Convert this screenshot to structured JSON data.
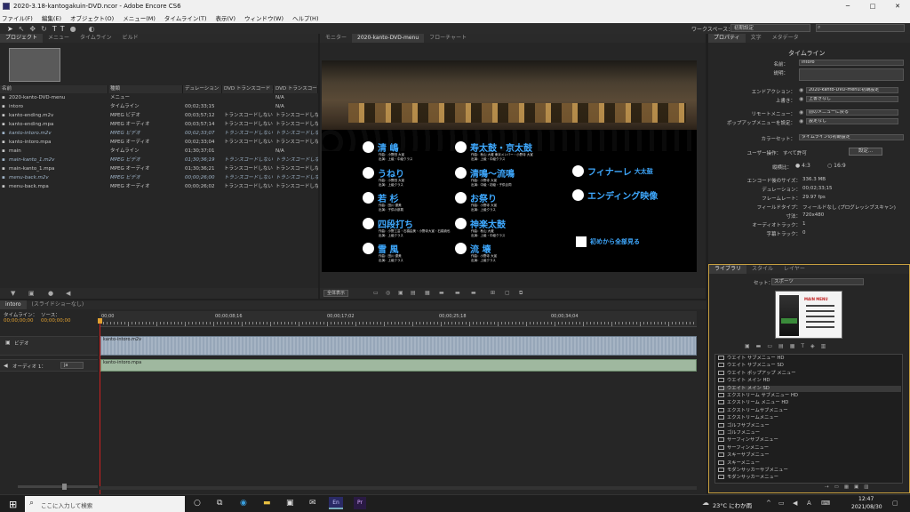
{
  "app": {
    "title": "2020-3.18-kantogakuin-DVD.ncor - Adobe Encore CS6",
    "window_controls": [
      "─",
      "□",
      "✕"
    ]
  },
  "menubar": [
    "ファイル(F)",
    "編集(E)",
    "オブジェクト(O)",
    "メニュー(M)",
    "タイムライン(T)",
    "表示(V)",
    "ウィンドウ(W)",
    "ヘルプ(H)"
  ],
  "workspace": {
    "label": "ワークスペース：",
    "value": "初期設定"
  },
  "project_panel": {
    "tabs": [
      "プロジェクト",
      "メニュー",
      "タイムライン",
      "ビルド"
    ],
    "columns": [
      "名前",
      "種類",
      "デュレーション",
      "DVD トランスコード ス...",
      "DVD トランスコード..."
    ],
    "rows": [
      {
        "name": "2020-kanto-DVD-menu",
        "type": "メニュー",
        "duration": "",
        "t1": "",
        "t2": "N/A",
        "italic": false
      },
      {
        "name": "intoro",
        "type": "タイムライン",
        "duration": "00;02;33;15",
        "t1": "",
        "t2": "N/A",
        "italic": false
      },
      {
        "name": "kanto-ending.m2v",
        "type": "MPEG ビデオ",
        "duration": "00;03;57;12",
        "t1": "トランスコードしない",
        "t2": "トランスコードしない",
        "italic": false
      },
      {
        "name": "kanto-ending.mpa",
        "type": "MPEG オーディオ",
        "duration": "00;03;57;14",
        "t1": "トランスコードしない",
        "t2": "トランスコードしない",
        "italic": false
      },
      {
        "name": "kanto-intoro.m2v",
        "type": "MPEG ビデオ",
        "duration": "00;02;33;07",
        "t1": "トランスコードしない",
        "t2": "トランスコードしない",
        "italic": true
      },
      {
        "name": "kanto-intoro.mpa",
        "type": "MPEG オーディオ",
        "duration": "00;02;33;04",
        "t1": "トランスコードしない",
        "t2": "トランスコードしない",
        "italic": false
      },
      {
        "name": "main",
        "type": "タイムライン",
        "duration": "01;30;37;01",
        "t1": "",
        "t2": "N/A",
        "italic": false
      },
      {
        "name": "main-kanto_1.m2v",
        "type": "MPEG ビデオ",
        "duration": "01;30;36;19",
        "t1": "トランスコードしない",
        "t2": "トランスコードしない",
        "italic": true
      },
      {
        "name": "main-kanto_1.mpa",
        "type": "MPEG オーディオ",
        "duration": "01;30;36;21",
        "t1": "トランスコードしない",
        "t2": "トランスコードしない",
        "italic": false
      },
      {
        "name": "menu-back.m2v",
        "type": "MPEG ビデオ",
        "duration": "00;00;26;00",
        "t1": "トランスコードしない",
        "t2": "トランスコードしない",
        "italic": true
      },
      {
        "name": "menu-back.mpa",
        "type": "MPEG オーディオ",
        "duration": "00;00;26;02",
        "t1": "トランスコードしない",
        "t2": "トランスコードしない",
        "italic": false
      }
    ]
  },
  "monitor": {
    "tabs": [
      "モニター",
      "2020-kanto-DVD-menu",
      "フローチャート"
    ],
    "zoom": "全体表示",
    "menu_buttons_left": [
      {
        "label": "清 嶋",
        "sub1": "作曲：小野田 大宣",
        "sub2": "出演：上級・中級クラス"
      },
      {
        "label": "うねり",
        "sub1": "作曲：小野田 大宣",
        "sub2": "出演：上級クラス"
      },
      {
        "label": "若 杉",
        "sub1": "作曲：田川 優美",
        "sub2": "出演：子供の部員"
      },
      {
        "label": "四段打ち",
        "sub1": "作曲：小野工芸・石橋由美・小野寺大宣・石橋貴也",
        "sub2": "出演：上級クラス"
      },
      {
        "label": "雪 風",
        "sub1": "作曲：田川 優美",
        "sub2": "出演：上級クラス"
      }
    ],
    "menu_buttons_mid": [
      {
        "label": "寿太鼓・京太鼓",
        "sub1": "作曲：秋山 大蔵 東京メンバー・小野寺 大宣",
        "sub2": "出演：上級・中級クラス"
      },
      {
        "label": "清鳴～流鳴",
        "sub1": "作曲：小野寺 大宣",
        "sub2": "出演：中級・初級・子供合同"
      },
      {
        "label": "お祭り",
        "sub1": "作曲：小野寺 大宣",
        "sub2": "出演：上級クラス"
      },
      {
        "label": "神楽太鼓",
        "sub1": "作曲：秋山 大蔵",
        "sub2": "出演：上級・中級クラス"
      },
      {
        "label": "流 壊",
        "sub1": "作曲：小野寺 大宣",
        "sub2": "出演：上級クラス"
      }
    ],
    "menu_buttons_right": [
      {
        "label": "フィナーレ",
        "extra": "大太鼓"
      },
      {
        "label": "エンディング映像",
        "extra": ""
      }
    ],
    "play_all": "初めから全部見る"
  },
  "properties": {
    "tabs": [
      "プロパティ",
      "文字",
      "メタデータ"
    ],
    "heading": "タイムライン",
    "name_label": "名前：",
    "name_value": "intoro",
    "desc_label": "説明：",
    "end_action_label": "エンドアクション：",
    "end_action_value": "2020-kanto-DVD-menu:初期設定",
    "override_label": "上書き：",
    "override_value": "上書きなし",
    "remote_label": "リモートメニュー：",
    "remote_value": "前のメニューに戻る",
    "popup_label": "ポップアップメニューを設定：",
    "popup_value": "設定なし",
    "colorset_label": "カラーセット：",
    "colorset_value": "タイムラインの初期設定",
    "user_label": "ユーザー操作：",
    "user_value": "すべて許可",
    "settings_button": "設定...",
    "aspect_label": "縦横比：",
    "aspect_opt1": "4:3",
    "aspect_opt2": "16:9",
    "info": [
      {
        "label": "エンコード後のサイズ：",
        "value": "336.3 MB"
      },
      {
        "label": "デュレーション：",
        "value": "00;02;33;15"
      },
      {
        "label": "フレームレート：",
        "value": "29.97 fps"
      },
      {
        "label": "フィールドタイプ：",
        "value": "フィールドなし (プログレッシブスキャン)"
      },
      {
        "label": "寸法：",
        "value": "720x480"
      },
      {
        "label": "オーディオトラック：",
        "value": "1"
      },
      {
        "label": "字幕トラック：",
        "value": "0"
      }
    ]
  },
  "library": {
    "tabs": [
      "ライブラリ",
      "スタイル",
      "レイヤー"
    ],
    "set_label": "セット：",
    "set_value": "スポーツ",
    "thumb_title": "MAIN MENU",
    "items": [
      "ウエイト サブメニュー HD",
      "ウエイト サブメニュー SD",
      "ウエイト ポップアップ メニュー",
      "ウエイト メイン HD",
      "ウエイト メイン SD",
      "エクストリーム サブメニュー HD",
      "エクストリーム メニュー HD",
      "エクストリームサブメニュー",
      "エクストリームメニュー",
      "ゴルフサブメニュー",
      "ゴルフメニュー",
      "サーフィンサブメニュー",
      "サーフィンメニュー",
      "スキーサブメニュー",
      "スキーメニュー",
      "モダンサッカーサブメニュー",
      "モダンサッカーメニュー"
    ],
    "selected_index": 4
  },
  "timeline": {
    "tabs": [
      "intoro",
      "(スライドショーなし)"
    ],
    "label_timeline": "タイムライン：",
    "label_source": "ソース：",
    "timecode_left": "00;00;00;00",
    "timecode_right": "00;00;00;00",
    "ruler": [
      "00;00",
      "00;00;08;16",
      "00;00;17;02",
      "00;00;25;18",
      "00;00;34;04"
    ],
    "video_track_label": "ビデオ",
    "video_clip": "kanto-intoro.m2v",
    "audio_track_label": "オーディオ 1：",
    "audio_lang": "ja",
    "audio_clip": "kanto-intoro.mpa"
  },
  "taskbar": {
    "search_placeholder": "ここに入力して検索",
    "weather": "23°C にわか雨",
    "time": "12:47",
    "date": "2021/08/30"
  }
}
